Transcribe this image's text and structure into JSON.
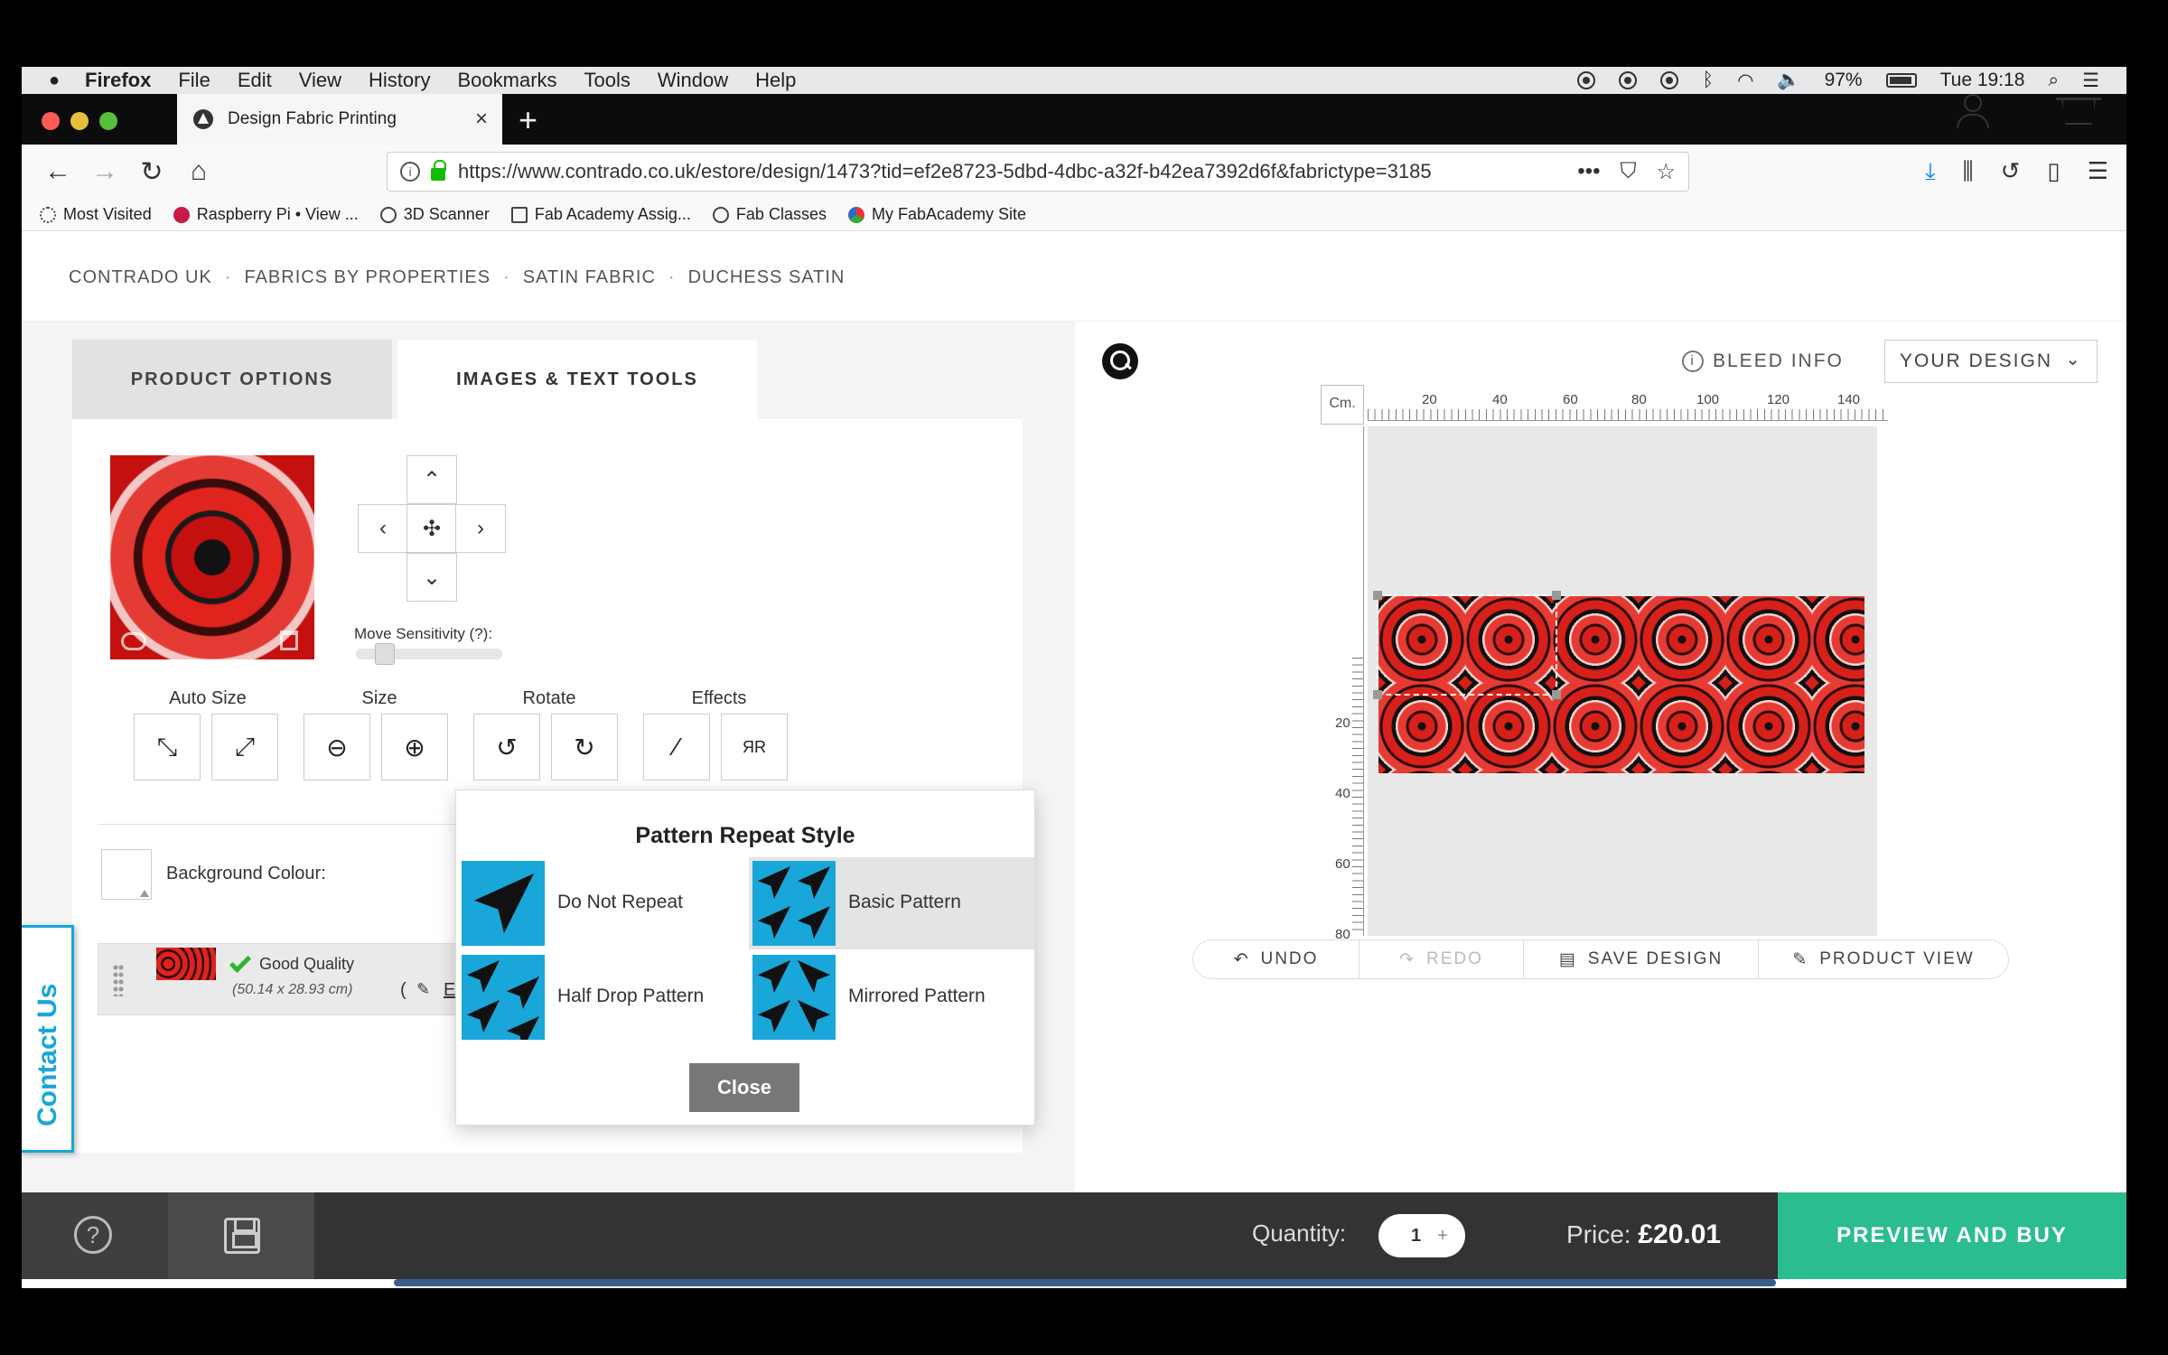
{
  "menubar": {
    "app": "Firefox",
    "items": [
      "File",
      "Edit",
      "View",
      "History",
      "Bookmarks",
      "Tools",
      "Window",
      "Help"
    ],
    "battery": "97%",
    "clock": "Tue 19:18"
  },
  "browser": {
    "tab_title": "Design Fabric Printing",
    "url": "https://www.contrado.co.uk/estore/design/1473?tid=ef2e8723-5dbd-4dbc-a32f-b42ea7392d6f&fabrictype=3185",
    "bookmarks": [
      "Most Visited",
      "Raspberry Pi • View ...",
      "3D Scanner",
      "Fab Academy Assig...",
      "Fab Classes",
      "My FabAcademy Site"
    ]
  },
  "breadcrumb": [
    "CONTRADO UK",
    "FABRICS BY PROPERTIES",
    "SATIN FABRIC",
    "DUCHESS SATIN"
  ],
  "tabs": {
    "options": "PRODUCT OPTIONS",
    "tools": "IMAGES & TEXT TOOLS"
  },
  "tools": {
    "move_sensitivity": "Move Sensitivity (?):",
    "sensitivity_level": 0.15,
    "groups": {
      "auto_size": "Auto Size",
      "size": "Size",
      "rotate": "Rotate",
      "effects": "Effects"
    },
    "background_label": "Background Colour:",
    "layer": {
      "quality": "Good Quality",
      "dims": "(50.14 x 28.93 cm)",
      "edit": "Edit"
    }
  },
  "popup": {
    "title": "Pattern Repeat Style",
    "options": [
      {
        "label": "Do Not Repeat",
        "selected": false
      },
      {
        "label": "Basic Pattern",
        "selected": true
      },
      {
        "label": "Half Drop Pattern",
        "selected": false
      },
      {
        "label": "Mirrored Pattern",
        "selected": false
      }
    ],
    "close": "Close",
    "accent": "#19a6d9"
  },
  "canvas": {
    "bleed_info": "BLEED INFO",
    "your_design": "YOUR DESIGN",
    "unit": "Cm.",
    "ruler_top": [
      "20",
      "40",
      "60",
      "80",
      "100",
      "120",
      "140"
    ],
    "ruler_left": [
      "20",
      "40",
      "60",
      "80"
    ],
    "toolbar": {
      "undo": "UNDO",
      "redo": "REDO",
      "save": "SAVE DESIGN",
      "view": "PRODUCT VIEW"
    }
  },
  "footer": {
    "quantity_label": "Quantity:",
    "quantity": "1",
    "plus": "+",
    "price_label": "Price:",
    "price": "£20.01",
    "buy": "PREVIEW AND BUY",
    "buy_color": "#2bbd8f",
    "help": "?"
  },
  "contact": "Contact Us"
}
